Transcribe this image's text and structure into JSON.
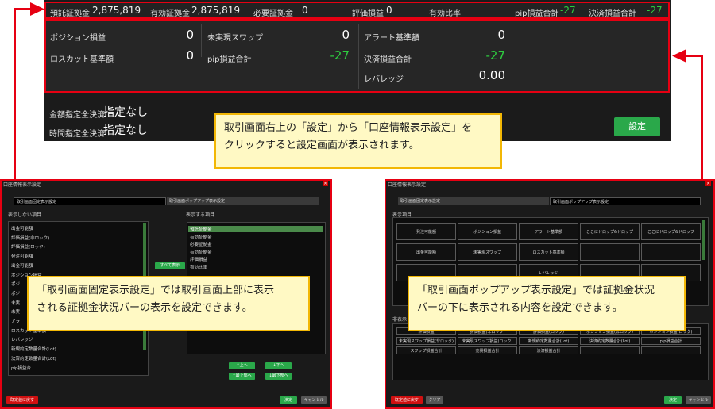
{
  "status_bar": {
    "items": [
      {
        "label": "預託証拠金",
        "value": "2,875,819"
      },
      {
        "label": "有効証拠金",
        "value": "2,875,819"
      },
      {
        "label": "必要証拠金",
        "value": "0"
      },
      {
        "label": "評価損益",
        "value": "0"
      },
      {
        "label": "有効比率",
        "value": ""
      },
      {
        "label": "pip損益合計",
        "value": "-27"
      },
      {
        "label": "決済損益合計",
        "value": "-27"
      }
    ]
  },
  "info_panel": {
    "col1": [
      {
        "label": "ポジション損益",
        "value": "0"
      },
      {
        "label": "ロスカット基準額",
        "value": "0"
      }
    ],
    "col2": [
      {
        "label": "未実現スワップ",
        "value": "0"
      },
      {
        "label": "pip損益合計",
        "value": "-27"
      }
    ],
    "col3": [
      {
        "label": "アラート基準額",
        "value": "0"
      },
      {
        "label": "決済損益合計",
        "value": "-27"
      },
      {
        "label": "レバレッジ",
        "value": "0.00"
      }
    ]
  },
  "settlement": {
    "amount_label": "金額指定全決済",
    "amount_value": "指定なし",
    "time_label": "時間指定全決済",
    "time_value": "指定なし",
    "settings_button": "設定"
  },
  "callouts": {
    "top": [
      "取引画面右上の「設定」から「口座情報表示設定」を",
      "クリックすると設定画面が表示されます。"
    ],
    "left": [
      "「取引画面固定表示設定」では取引画面上部に表示",
      "される証拠金状況バーの表示を設定できます。"
    ],
    "right": [
      "「取引画面ポップアップ表示設定」では証拠金状況",
      "バーの下に表示される内容を設定できます。"
    ]
  },
  "dialog_left": {
    "title": "口座情報表示設定",
    "tab_active": "取引画面固定表示設定",
    "tab_inactive": "取引画面ポップアップ表示設定",
    "hidden_caption": "表示しない項目",
    "shown_caption": "表示する項目",
    "hidden_items": [
      "出金可能額",
      "評価損益(非ロック)",
      "評価損益(ロック)",
      "発注可能額",
      "出金可能額",
      "ポジション損益",
      "ポジ",
      "ポジ",
      "未実",
      "未実",
      "アラ",
      "ロスカット基準額",
      "レバレッジ",
      "新規約定数量合計(Lot)",
      "決済約定数量合計(Lot)",
      "pip損益合"
    ],
    "shown_items": [
      "預託証拠金",
      "有効証拠金",
      "必要証拠金",
      "有効証拠金",
      "評価損益",
      "有効比率"
    ],
    "add_button": "すべて表示",
    "up_button": "↑上へ",
    "top_button": "↑最上部へ",
    "down_button": "↓下へ",
    "bottom_button": "↓最下部へ",
    "reset_button": "既定値に戻す",
    "ok_button": "決定",
    "cancel_button": "キャンセル"
  },
  "dialog_right": {
    "title": "口座情報表示設定",
    "tab_inactive": "取引画面固定表示設定",
    "tab_active": "取引画面ポップアップ表示設定",
    "shown_caption": "表示項目",
    "hidden_caption": "非表示",
    "grid_rows": [
      [
        "発注可能額",
        "ポジション損益",
        "アラート基準額",
        "ここにドロップ&ドロップ",
        "ここにドロップ&ドロップ"
      ],
      [
        "出金可能額",
        "未実現スワップ",
        "ロスカット基準額",
        "",
        ""
      ],
      [
        "",
        "",
        "レバレッジ",
        "",
        ""
      ]
    ],
    "hidden_rows": [
      [
        "評価損益",
        "評価損益(非ロック)",
        "評価損益(ロック)",
        "ポジション損益(非ロック)",
        "ポジション損益(ロック)"
      ],
      [
        "未実現スワップ損益(非ロック)",
        "未実現スワップ損益(ロック)",
        "新規約定数量合計(Lot)",
        "決済約定数量合計(Lot)",
        "pip損益合計"
      ],
      [
        "スワップ損益合計",
        "売買損益合計",
        "決済損益合計",
        "",
        ""
      ]
    ],
    "reset_button": "既定値に戻す",
    "clear_button": "クリア",
    "ok_button": "決定",
    "cancel_button": "キャンセル"
  },
  "colors": {
    "accent_red": "#e60012",
    "positive_green": "#2ecc40",
    "button_green": "#2aa84a",
    "callout_bg": "#fff9c4"
  }
}
